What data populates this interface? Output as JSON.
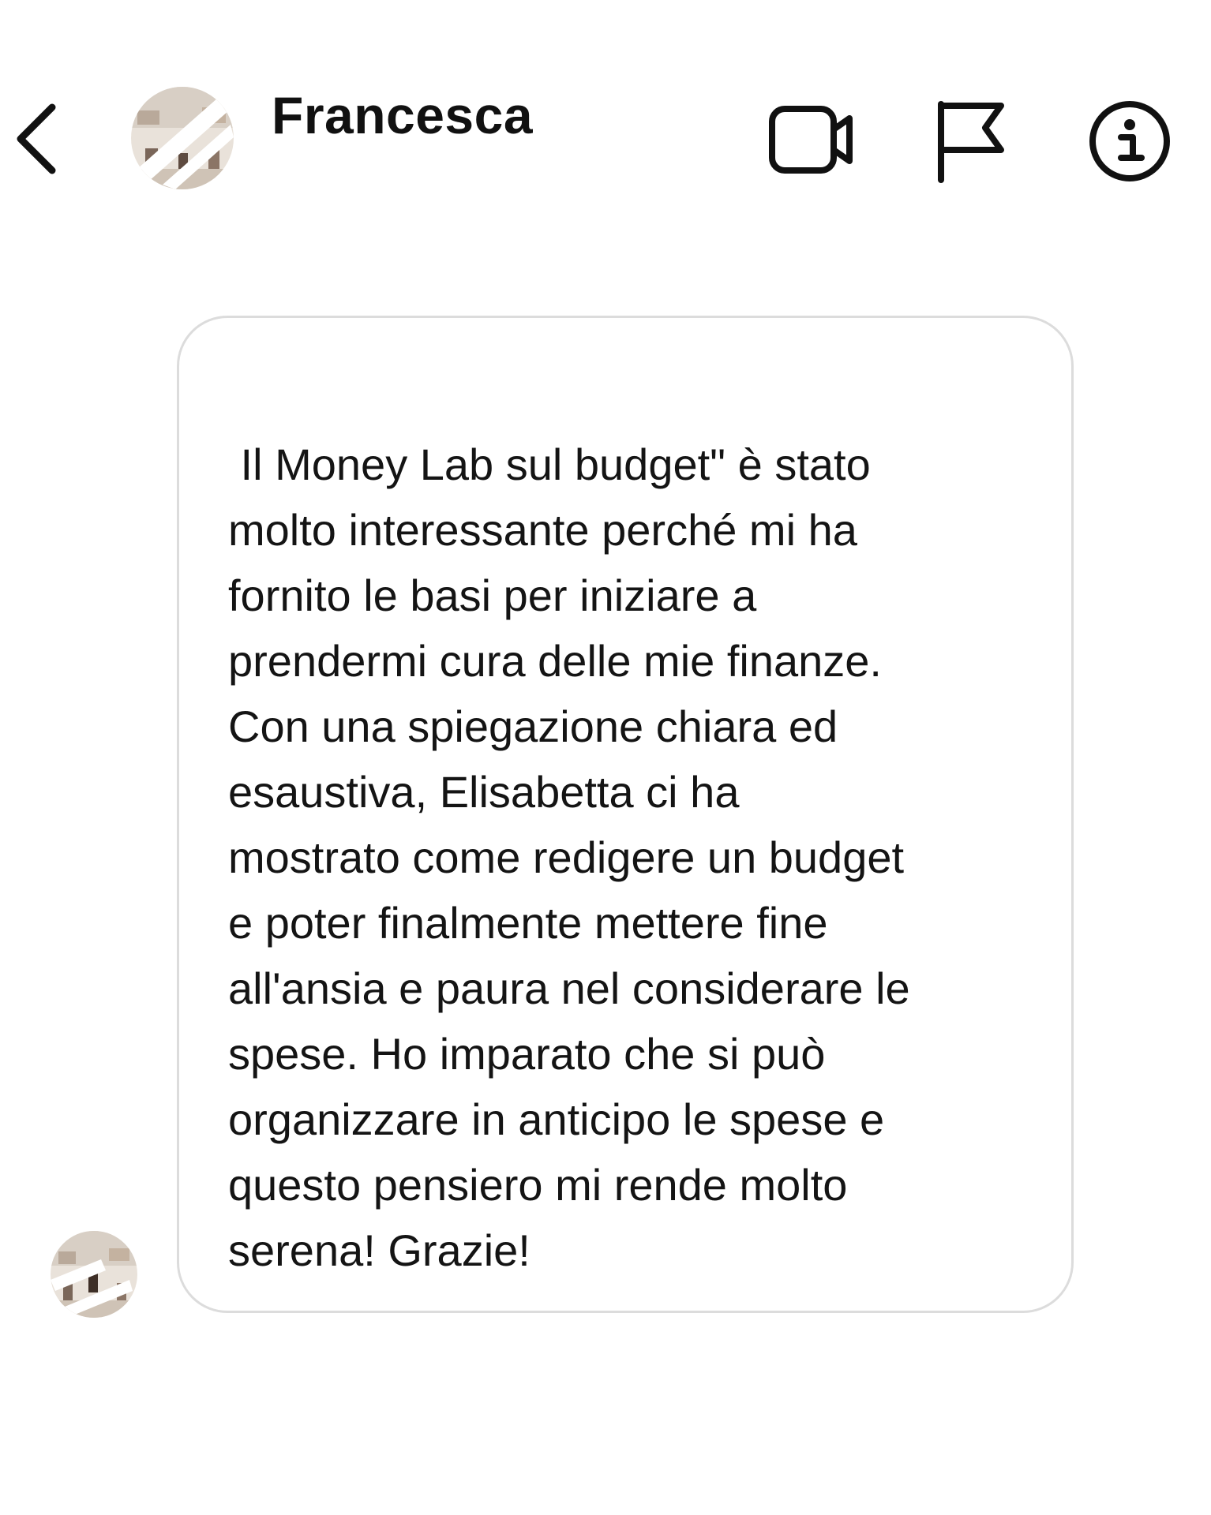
{
  "header": {
    "contact_name": "Francesca",
    "icons": {
      "back": "chevron-left-icon",
      "video": "video-camera-icon",
      "report": "flag-icon",
      "info": "info-icon"
    }
  },
  "message": {
    "text": " Il Money Lab sul budget\" è stato\nmolto interessante perché mi ha\nfornito le basi per iniziare a\nprendermi cura delle mie finanze.\nCon una spiegazione chiara ed\nesaustiva, Elisabetta ci ha\nmostrato come redigere un budget\ne poter finalmente mettere fine\nall'ansia e paura nel considerare le\nspese. Ho imparato che si può\norganizzare in anticipo le spese e\nquesto pensiero mi rende molto\nserena! Grazie!"
  },
  "colors": {
    "background": "#ffffff",
    "text": "#141414",
    "bubble_border": "#dcdcdc",
    "icon_stroke": "#111111"
  }
}
